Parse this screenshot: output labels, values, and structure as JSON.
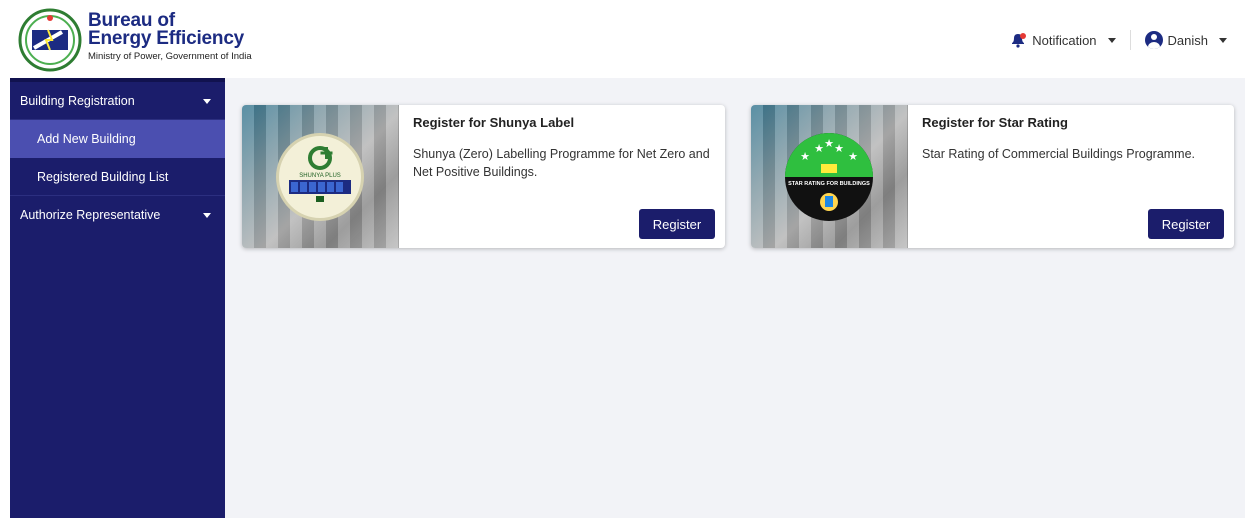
{
  "brand": {
    "line1": "Bureau of",
    "line2": "Energy Efficiency",
    "subtitle": "Ministry of Power, Government of India"
  },
  "header": {
    "notification_label": "Notification",
    "user_name": "Danish"
  },
  "sidebar": {
    "items": [
      {
        "label": "Building Registration",
        "type": "parent",
        "expanded": true
      },
      {
        "label": "Add New Building",
        "type": "sub",
        "active": true
      },
      {
        "label": "Registered Building List",
        "type": "sub"
      },
      {
        "label": "Authorize Representative",
        "type": "parent",
        "expanded": false
      }
    ]
  },
  "cards": [
    {
      "title": "Register for Shunya Label",
      "description": "Shunya (Zero) Labelling Programme for Net Zero and Net Positive Buildings.",
      "button_label": "Register",
      "badge_text": "SHUNYA PLUS"
    },
    {
      "title": "Register for Star Rating",
      "description": "Star Rating of Commercial Buildings Programme.",
      "button_label": "Register",
      "badge_text": "STAR RATING FOR BUILDINGS"
    }
  ],
  "colors": {
    "brand_blue": "#1c2b82",
    "sidebar_bg": "#1b1d6b",
    "sidebar_active": "#4b4fb0",
    "main_bg": "#f2f3f7",
    "notification_bell": "#c0392b",
    "star_green": "#2fbf3f"
  },
  "icons": {
    "notification": "bell-icon",
    "user": "user-circle-icon"
  }
}
